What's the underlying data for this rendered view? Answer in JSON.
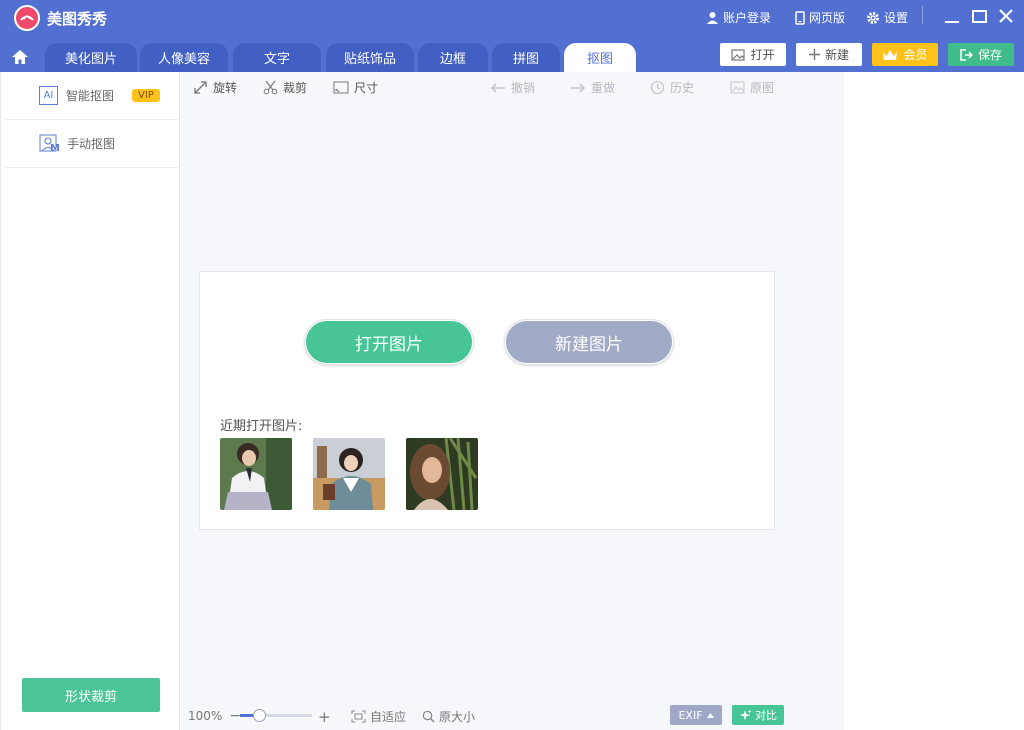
{
  "app": {
    "title": "美图秀秀"
  },
  "titlebar": {
    "login": "账户登录",
    "web_version": "网页版",
    "settings": "设置"
  },
  "tabs": [
    {
      "label": "美化图片"
    },
    {
      "label": "人像美容"
    },
    {
      "label": "文字"
    },
    {
      "label": "贴纸饰品"
    },
    {
      "label": "边框"
    },
    {
      "label": "拼图"
    },
    {
      "label": "抠图",
      "active": true
    }
  ],
  "actions": {
    "open": "打开",
    "new": "新建",
    "vip": "会员",
    "save": "保存"
  },
  "sidebar": {
    "items": [
      {
        "icon_text": "AI",
        "label": "智能抠图",
        "badge": "VIP"
      },
      {
        "icon_text": "M",
        "label": "手动抠图"
      }
    ],
    "shape_crop": "形状裁剪"
  },
  "toolbar": {
    "rotate": "旋转",
    "crop": "裁剪",
    "size": "尺寸",
    "undo": "撤销",
    "redo": "重做",
    "history": "历史",
    "original": "原图"
  },
  "start_panel": {
    "open_image": "打开图片",
    "new_image": "新建图片",
    "recent_label": "近期打开图片:",
    "recent_count": 3
  },
  "bottom_bar": {
    "zoom": "100%",
    "zoom_fraction": 0.27,
    "fit": "自适应",
    "actual_size": "原大小",
    "exif": "EXIF",
    "compare": "对比"
  },
  "colors": {
    "header": "#5270d2",
    "accent_green": "#48c596",
    "vip_yellow": "#ffc21a"
  }
}
